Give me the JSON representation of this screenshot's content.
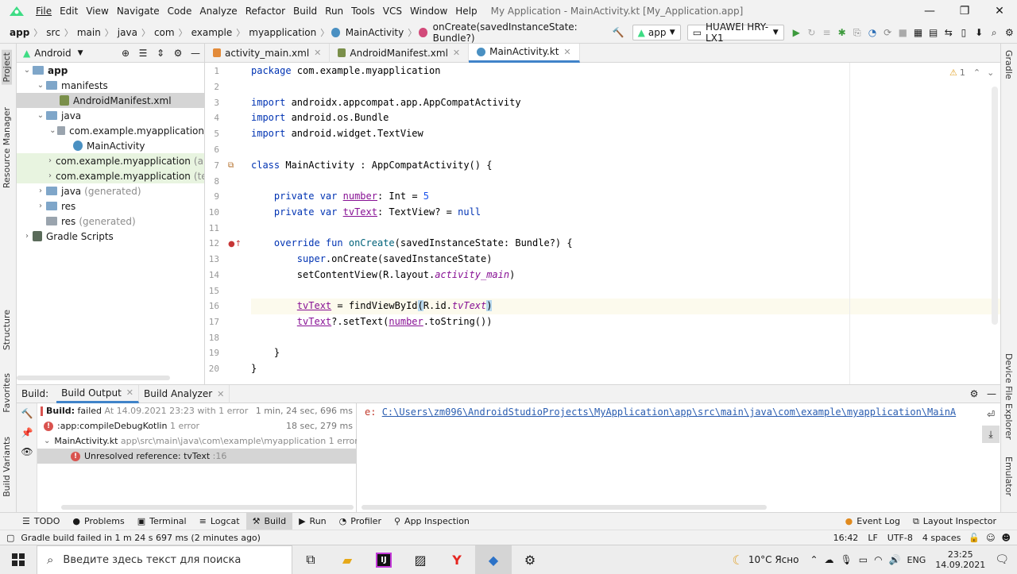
{
  "menu": {
    "items": [
      "File",
      "Edit",
      "View",
      "Navigate",
      "Code",
      "Analyze",
      "Refactor",
      "Build",
      "Run",
      "Tools",
      "VCS",
      "Window",
      "Help"
    ],
    "window_title": "My Application - MainActivity.kt [My_Application.app]"
  },
  "navbar": {
    "crumbs": [
      "app",
      "src",
      "main",
      "java",
      "com",
      "example",
      "myapplication",
      "MainActivity",
      "onCreate(savedInstanceState: Bundle?)"
    ],
    "run_config": "app",
    "device": "HUAWEI HRY-LX1"
  },
  "project": {
    "view_mode": "Android",
    "tree": [
      {
        "label": "app",
        "indent": 0,
        "arrow": "v",
        "kind": "folder",
        "bold": true
      },
      {
        "label": "manifests",
        "indent": 1,
        "arrow": "v",
        "kind": "folder"
      },
      {
        "label": "AndroidManifest.xml",
        "indent": 2,
        "arrow": "",
        "kind": "manifest",
        "selected": true
      },
      {
        "label": "java",
        "indent": 1,
        "arrow": "v",
        "kind": "folder"
      },
      {
        "label": "com.example.myapplication",
        "indent": 2,
        "arrow": "v",
        "kind": "package"
      },
      {
        "label": "MainActivity",
        "indent": 3,
        "arrow": "",
        "kind": "class"
      },
      {
        "label": "com.example.myapplication",
        "suffix": "(an",
        "indent": 2,
        "arrow": ">",
        "kind": "package",
        "green": true
      },
      {
        "label": "com.example.myapplication",
        "suffix": "(tes",
        "indent": 2,
        "arrow": ">",
        "kind": "package",
        "green": true
      },
      {
        "label": "java",
        "suffix": "(generated)",
        "indent": 1,
        "arrow": ">",
        "kind": "folder"
      },
      {
        "label": "res",
        "indent": 1,
        "arrow": ">",
        "kind": "folder"
      },
      {
        "label": "res",
        "suffix": "(generated)",
        "indent": 1,
        "arrow": "",
        "kind": "folder-grey"
      },
      {
        "label": "Gradle Scripts",
        "indent": 0,
        "arrow": ">",
        "kind": "gradle"
      }
    ]
  },
  "editor": {
    "tabs": [
      {
        "label": "activity_main.xml",
        "active": false
      },
      {
        "label": "AndroidManifest.xml",
        "active": false
      },
      {
        "label": "MainActivity.kt",
        "active": true
      }
    ],
    "warning_count": "1",
    "line_numbers": [
      "1",
      "2",
      "3",
      "4",
      "5",
      "6",
      "7",
      "8",
      "9",
      "10",
      "11",
      "12",
      "13",
      "14",
      "15",
      "16",
      "17",
      "18",
      "19",
      "20"
    ]
  },
  "build": {
    "label": "Build:",
    "tabs": [
      "Build Output",
      "Build Analyzer"
    ],
    "rows": [
      {
        "bold": "Build:",
        "text": "failed",
        "muted": "At 14.09.2021 23:23 with 1 error",
        "time": "1 min, 24 sec, 696 ms"
      },
      {
        "text": ":app:compileDebugKotlin",
        "muted": "1 error",
        "time": "18 sec, 279 ms"
      },
      {
        "text": "MainActivity.kt",
        "muted": "app\\src\\main\\java\\com\\example\\myapplication 1 error"
      },
      {
        "text": "Unresolved reference: tvText",
        "muted": ":16"
      }
    ],
    "output_prefix": "e:",
    "output_link": "C:\\Users\\zm096\\AndroidStudioProjects\\MyApplication\\app\\src\\main\\java\\com\\example\\myapplication\\MainA"
  },
  "bottom_tabs": [
    "TODO",
    "Problems",
    "Terminal",
    "Logcat",
    "Build",
    "Run",
    "Profiler",
    "App Inspection"
  ],
  "bottom_right_tabs": [
    "Event Log",
    "Layout Inspector"
  ],
  "status": {
    "message": "Gradle build failed in 1 m 24 s 697 ms (2 minutes ago)",
    "position": "16:42",
    "line_sep": "LF",
    "encoding": "UTF-8",
    "indent": "4 spaces"
  },
  "left_stripe": [
    "Project",
    "Resource Manager",
    "Structure",
    "Favorites",
    "Build Variants"
  ],
  "right_stripe": [
    "Gradle",
    "Device File Explorer",
    "Emulator"
  ],
  "taskbar": {
    "search_placeholder": "Введите здесь текст для поиска",
    "weather": "10°C Ясно",
    "lang": "ENG",
    "time": "23:25",
    "date": "14.09.2021"
  }
}
